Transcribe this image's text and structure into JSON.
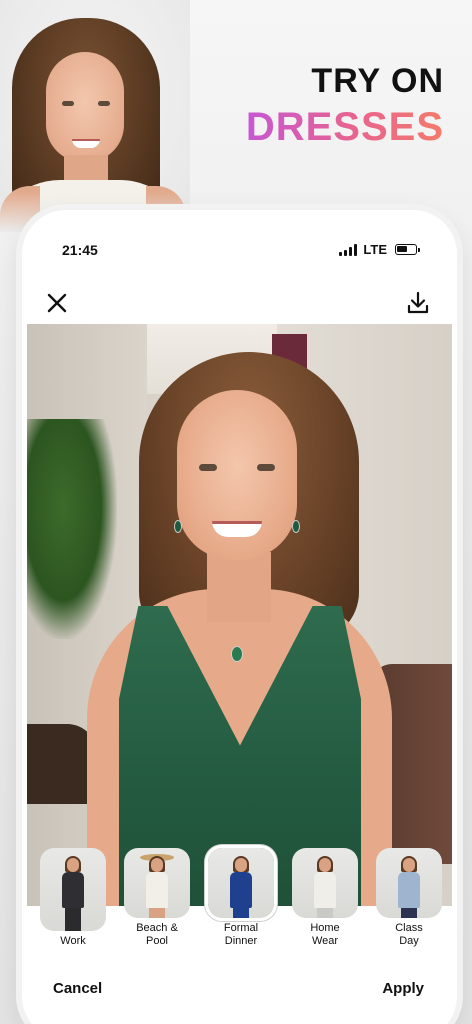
{
  "headline": {
    "line1": "TRY ON",
    "line2": "DRESSES"
  },
  "status": {
    "time": "21:45",
    "network": "LTE",
    "battery_level": 0.6
  },
  "toolbar": {
    "close_icon": "close-icon",
    "download_icon": "download-icon"
  },
  "outfits": [
    {
      "label": "Work",
      "icon": "work-outfit",
      "body": "#2f2f33",
      "legs": "#2b2b2e"
    },
    {
      "label": "Beach & Pool",
      "icon": "beach-outfit",
      "body": "#f1efe8",
      "legs": "#d9a283"
    },
    {
      "label": "Formal Dinner",
      "icon": "formal-outfit",
      "body": "#1f3f8f",
      "legs": "#1f3f8f",
      "selected": true
    },
    {
      "label": "Home Wear",
      "icon": "home-outfit",
      "body": "#efeee9",
      "legs": "#c9c9c6"
    },
    {
      "label": "Class Day",
      "icon": "class-outfit",
      "body": "#9fb4cf",
      "legs": "#2b3350"
    }
  ],
  "actions": {
    "cancel": "Cancel",
    "apply": "Apply"
  }
}
